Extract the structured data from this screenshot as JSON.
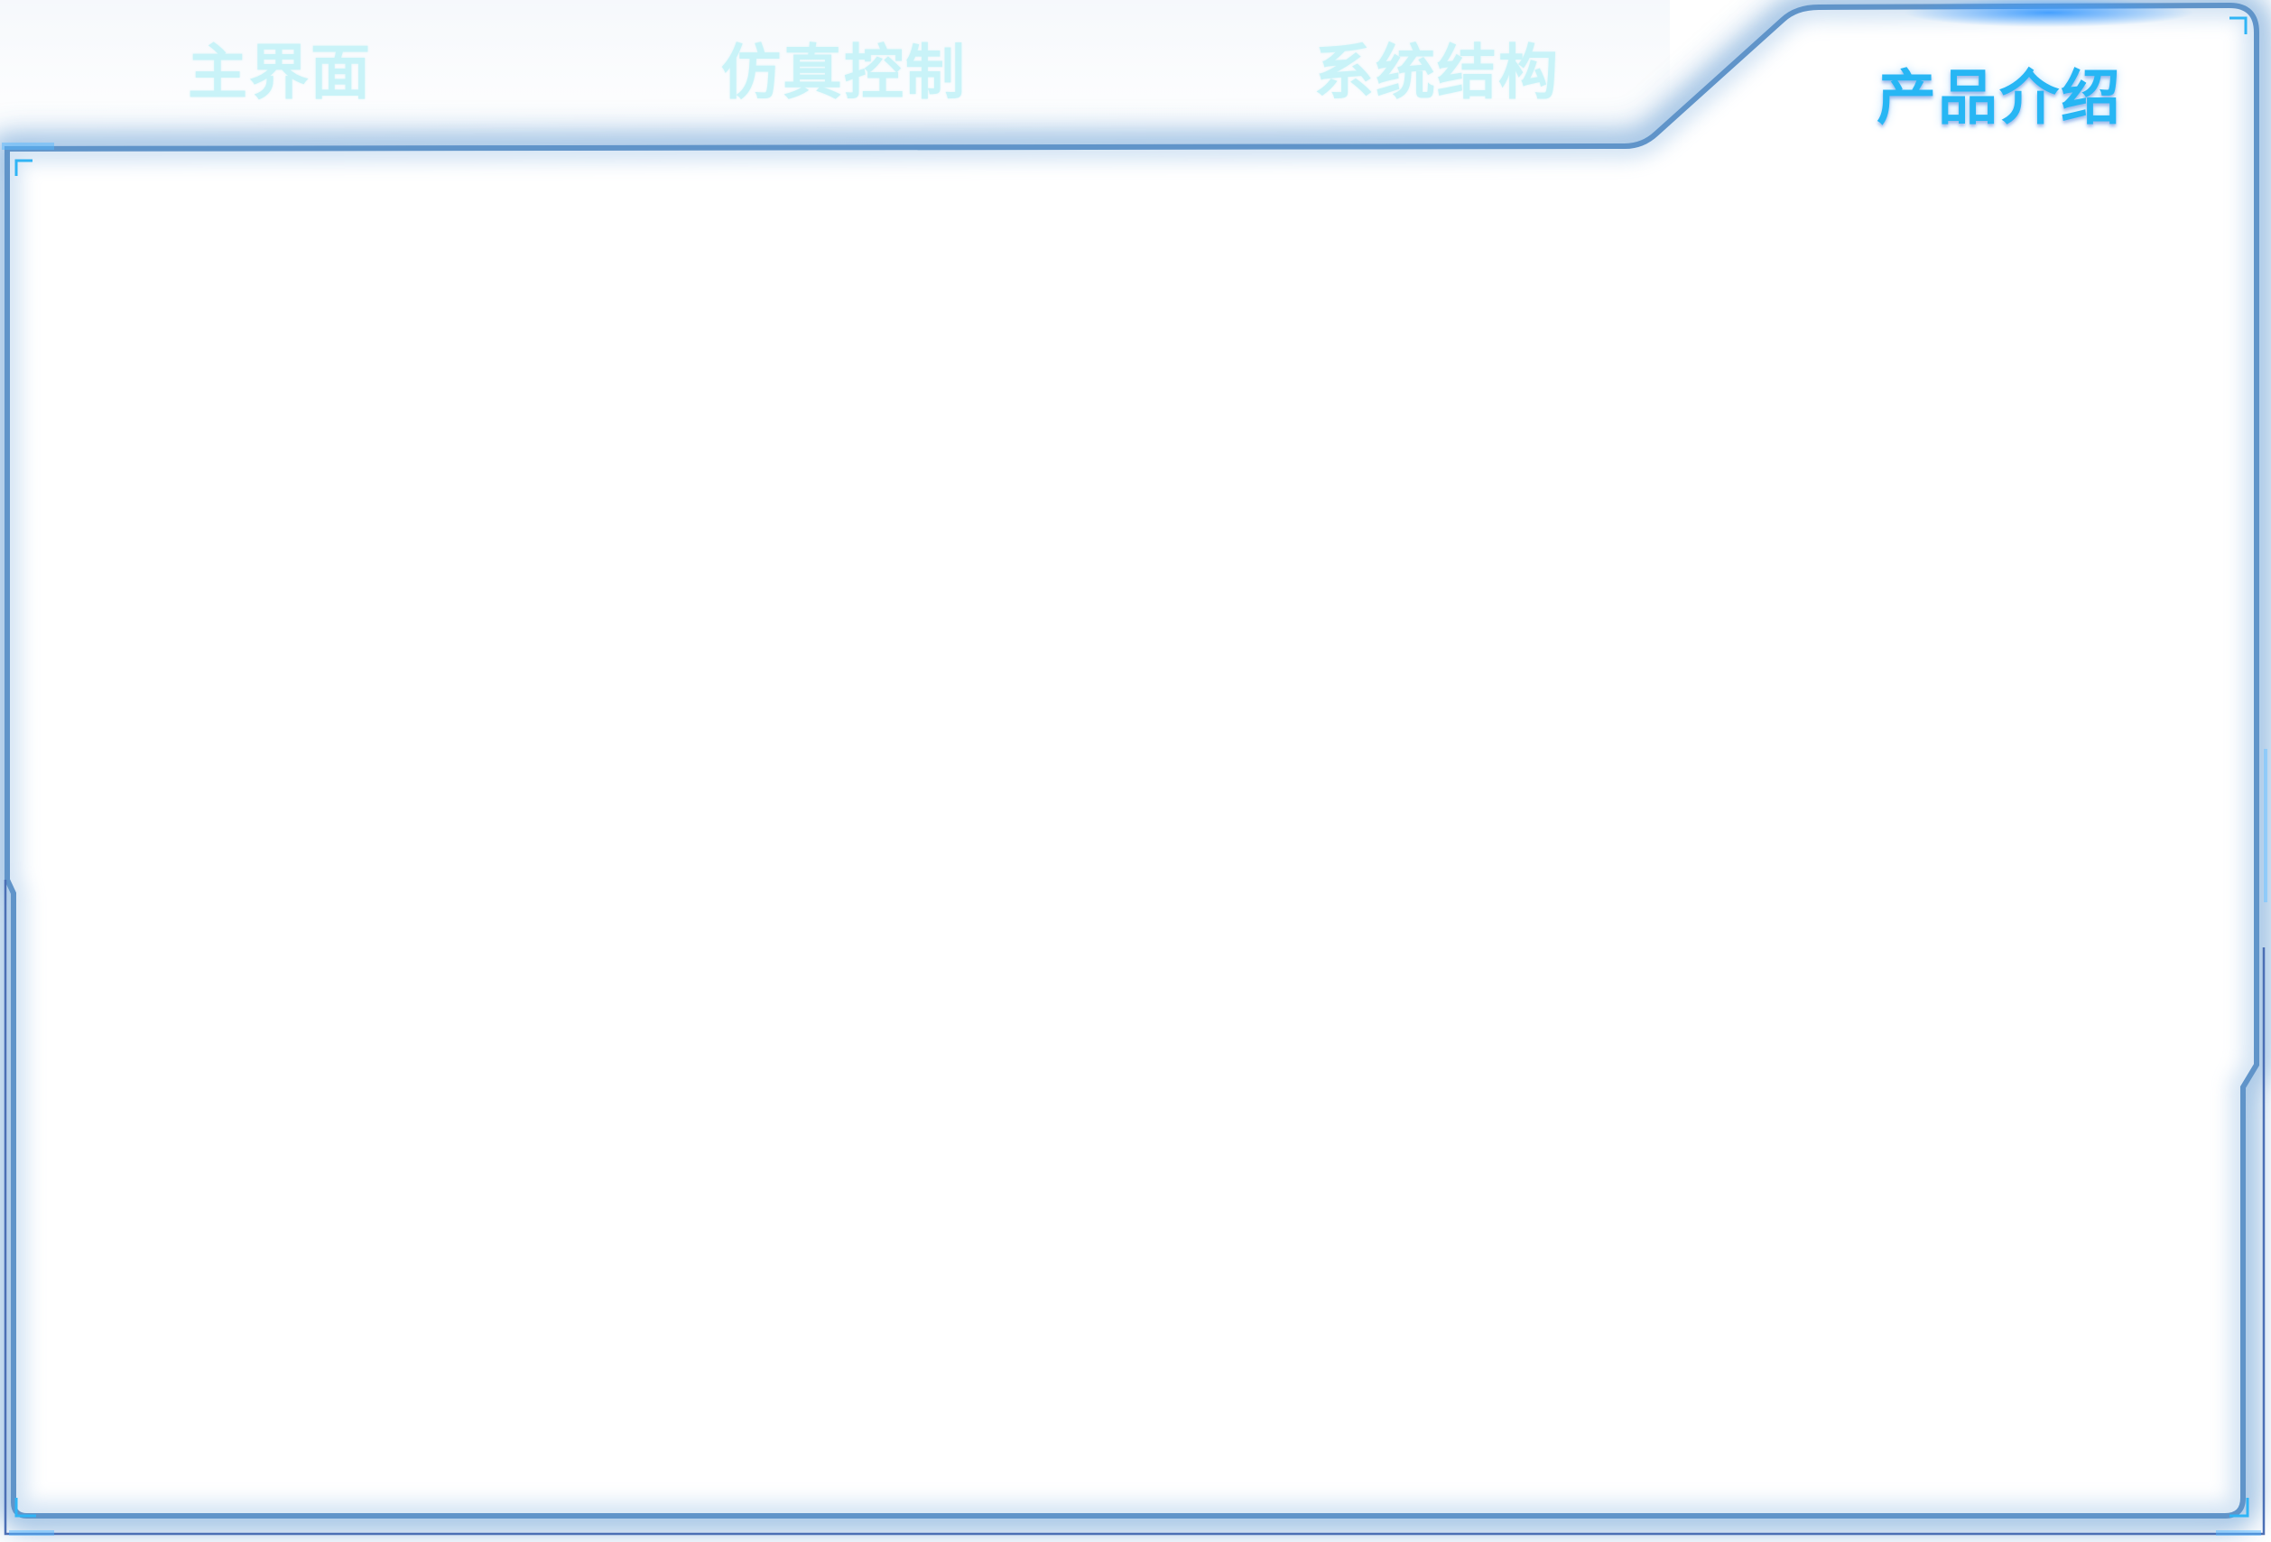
{
  "tabs": [
    {
      "label": "主界面",
      "active": false
    },
    {
      "label": "仿真控制",
      "active": false
    },
    {
      "label": "系统结构",
      "active": false
    },
    {
      "label": "产品介绍",
      "active": true
    }
  ],
  "colors": {
    "frame_border": "#5d8dbf",
    "frame_glow": "#2f73b8",
    "accent": "#2fb4f5",
    "inactive_tab_text": "#c9f3f8",
    "active_tab_text": "#27b6f4",
    "background": "#ffffff"
  }
}
